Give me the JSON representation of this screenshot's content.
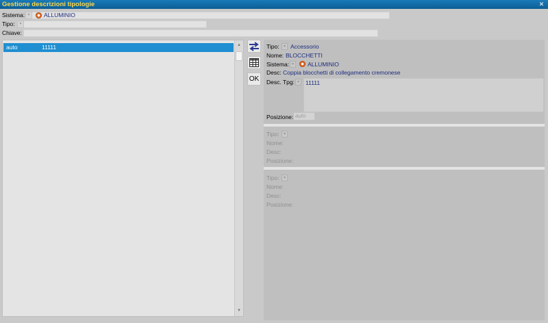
{
  "window": {
    "title": "Gestione descrizioni tipologie",
    "close_glyph": "✕"
  },
  "filters": {
    "sistema_label": "Sistema:",
    "sistema_value": "ALLUMINIO",
    "tipo_label": "Tipo:",
    "chiave_label": "Chiave:"
  },
  "list": {
    "rows": [
      {
        "col1": "auto",
        "col2": "11111"
      }
    ]
  },
  "toolbar": {
    "ok_label": "OK"
  },
  "detail": {
    "tipo_label": "Tipo:",
    "tipo_value": "Accessorio",
    "nome_label": "Nome:",
    "nome_value": "BLOCCHETTI",
    "sistema_label": "Sistema:",
    "sistema_value": "ALLUMINIO",
    "desc_label": "Desc:",
    "desc_value": "Coppia blocchetti di collegamento cremonese",
    "desc_tpg_label": "Desc. Tpg:",
    "desc_tpg_value": "11111",
    "posizione_label": "Posizione:",
    "posizione_placeholder": "auto"
  },
  "section2": {
    "tipo_label": "Tipo:",
    "nome_label": "Nome:",
    "desc_label": "Desc:",
    "posizione_label": "Posizione:"
  },
  "section3": {
    "tipo_label": "Tipo:",
    "nome_label": "Nome:",
    "desc_label": "Desc:",
    "posizione_label": "Posizione:"
  },
  "colors": {
    "title_bar": "#1a7ab8",
    "title_text": "#ffd84a",
    "selection": "#1f8fd1",
    "value_text": "#1d2d7d",
    "icon_accent": "#2b3a8f"
  }
}
